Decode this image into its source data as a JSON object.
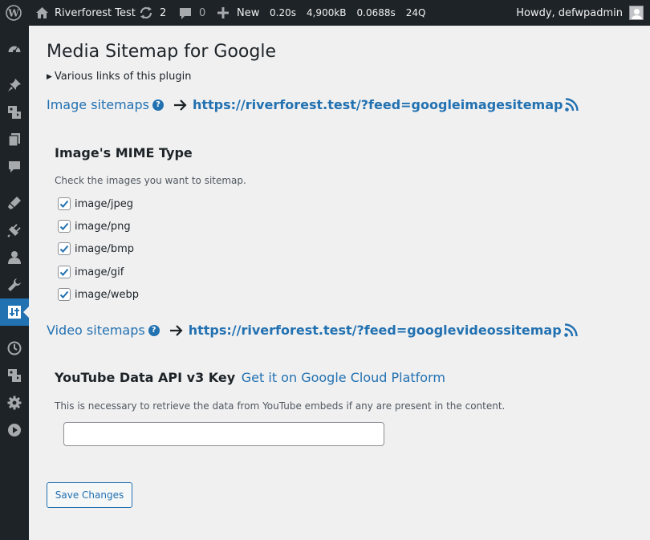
{
  "adminbar": {
    "site_name": "Riverforest Test",
    "updates_count": "2",
    "comments_count": "0",
    "new_label": "New",
    "stats": {
      "time": "0.20s",
      "memory": "4,900kB",
      "query_time": "0.0688s",
      "queries": "24Q"
    },
    "greeting": "Howdy, defwpadmin"
  },
  "sidebar": {
    "items": [
      {
        "icon": "dashboard-icon"
      },
      {
        "icon": "pin-icon"
      },
      {
        "icon": "media-icon"
      },
      {
        "icon": "pages-icon"
      },
      {
        "icon": "comments-icon"
      },
      {
        "icon": "appearance-icon"
      },
      {
        "icon": "plugins-icon"
      },
      {
        "icon": "users-icon"
      },
      {
        "icon": "tools-icon"
      },
      {
        "icon": "settings-icon",
        "current": true
      },
      {
        "icon": "clock-icon"
      },
      {
        "icon": "media-icon"
      },
      {
        "icon": "gear-icon"
      },
      {
        "icon": "play-icon"
      }
    ]
  },
  "page": {
    "title": "Media Sitemap for Google",
    "details_summary": "Various links of this plugin",
    "image_sitemap": {
      "title": "Image sitemaps",
      "url": "https://riverforest.test/?feed=googleimagesitemap"
    },
    "mime": {
      "title": "Image's MIME Type",
      "description": "Check the images you want to sitemap.",
      "types": [
        {
          "label": "image/jpeg",
          "checked": true
        },
        {
          "label": "image/png",
          "checked": true
        },
        {
          "label": "image/bmp",
          "checked": true
        },
        {
          "label": "image/gif",
          "checked": true
        },
        {
          "label": "image/webp",
          "checked": true
        }
      ]
    },
    "video_sitemap": {
      "title": "Video sitemaps",
      "url": "https://riverforest.test/?feed=googlevideossitemap"
    },
    "youtube": {
      "title": "YouTube Data API v3 Key",
      "link_text": "Get it on Google Cloud Platform",
      "description": "This is necessary to retrieve the data from YouTube embeds if any are present in the content.",
      "api_key_value": ""
    },
    "save_label": "Save Changes"
  },
  "colors": {
    "accent": "#2271b1",
    "adminbar": "#1d2327",
    "background": "#f0f0f1"
  }
}
